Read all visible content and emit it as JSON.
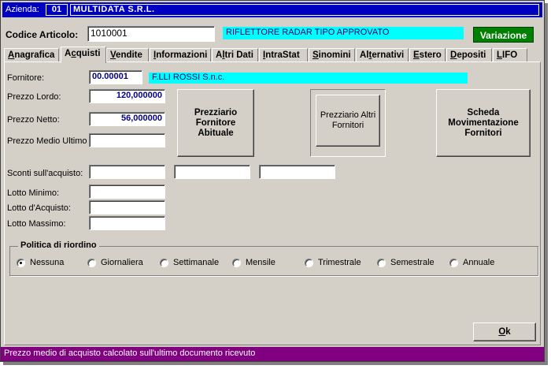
{
  "azienda": {
    "label": "Azienda:",
    "code": "01",
    "name": "MULTIDATA S.R.L."
  },
  "articolo": {
    "label": "Codice Articolo:",
    "code": "1010001",
    "description": "RIFLETTORE RADAR TIPO APPROVATO"
  },
  "mode_badge": "Variazione",
  "tabs": [
    {
      "pre": "",
      "u": "A",
      "post": "nagrafica"
    },
    {
      "pre": "A",
      "u": "c",
      "post": "quisti"
    },
    {
      "pre": "",
      "u": "V",
      "post": "endite"
    },
    {
      "pre": "",
      "u": "I",
      "post": "nformazioni"
    },
    {
      "pre": "A",
      "u": "l",
      "post": "tri Dati"
    },
    {
      "pre": "",
      "u": "I",
      "post": "ntraStat"
    },
    {
      "pre": "",
      "u": "S",
      "post": "inomini"
    },
    {
      "pre": "Al",
      "u": "t",
      "post": "ernativi"
    },
    {
      "pre": "",
      "u": "E",
      "post": "stero"
    },
    {
      "pre": "",
      "u": "D",
      "post": "epositi"
    },
    {
      "pre": "",
      "u": "L",
      "post": "IFO"
    }
  ],
  "fornitore": {
    "label": "Fornitore:",
    "code": "00.00001",
    "name": "F.LLI ROSSI S.n.c."
  },
  "prezzo_lordo": {
    "label": "Prezzo Lordo:",
    "value": "120,000000"
  },
  "prezzo_netto": {
    "label": "Prezzo Netto:",
    "value": "56,000000"
  },
  "prezzo_medio": {
    "label": "Prezzo Medio Ultimo",
    "value": ""
  },
  "sconti": {
    "label": "Sconti sull'acquisto:",
    "values": [
      "",
      "",
      ""
    ]
  },
  "lotto_minimo": {
    "label": "Lotto Minimo:",
    "value": ""
  },
  "lotto_acquisto": {
    "label": "Lotto d'Acquisto:",
    "value": ""
  },
  "lotto_massimo": {
    "label": "Lotto Massimo:",
    "value": ""
  },
  "buttons": {
    "prezziario_abituale": "Prezziario Fornitore Abituale",
    "prezziario_altri": "Prezziario Altri Fornitori",
    "scheda_movimentazione": "Scheda Movimentazione Fornitori",
    "ok_pre": "",
    "ok_u": "O",
    "ok_post": "k"
  },
  "politica": {
    "title": "Politica di riordino",
    "options": [
      "Nessuna",
      "Giornaliera",
      "Settimanale",
      "Mensile",
      "Trimestrale",
      "Semestrale",
      "Annuale"
    ],
    "selected": "Nessuna"
  },
  "status": "Prezzo medio di acquisto calcolato sull'ultimo documento ricevuto",
  "colors": {
    "title_bar": "#0000c0",
    "highlight": "#00ffff",
    "badge": "#008000",
    "status_bar": "#800080",
    "value_text": "#000080"
  }
}
